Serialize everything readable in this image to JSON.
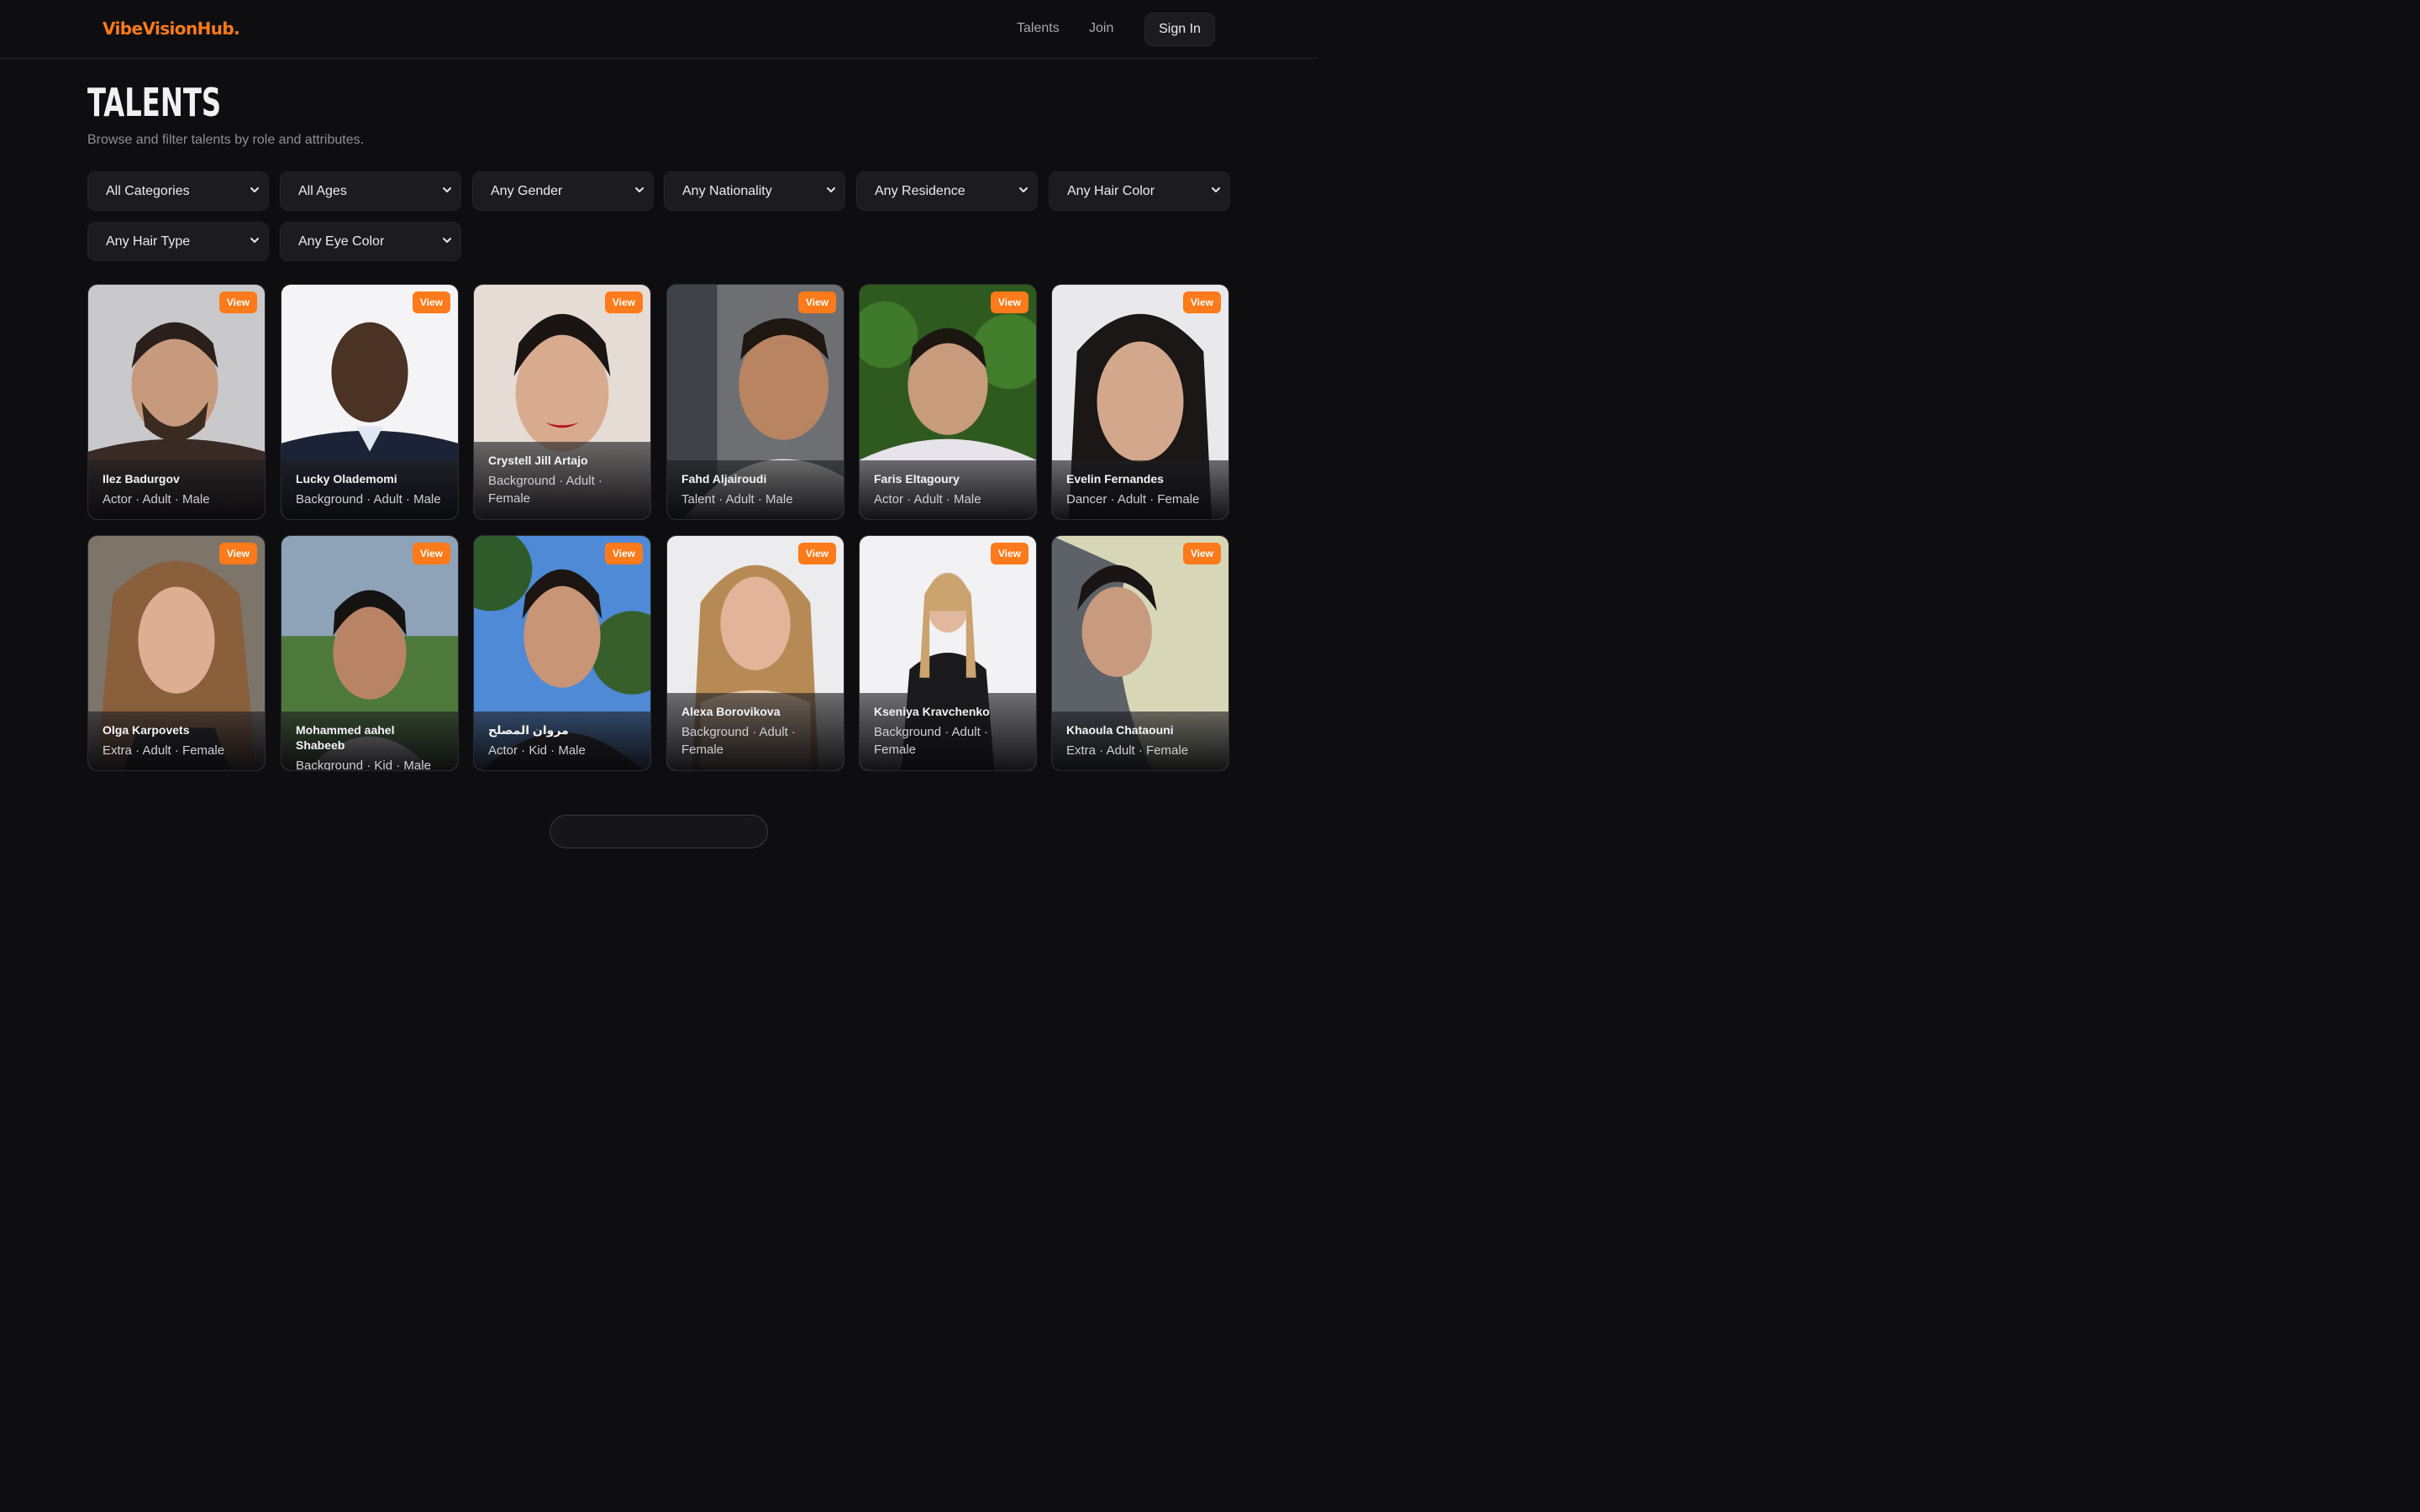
{
  "brand": {
    "logo": "VibeVisionHub.",
    "accent": "#ff7a1a"
  },
  "nav": {
    "talents": "Talents",
    "join": "Join",
    "signin": "Sign In"
  },
  "page": {
    "title": "TALENTS",
    "subtitle": "Browse and filter talents by role and attributes."
  },
  "filters": [
    "All Categories",
    "All Ages",
    "Any Gender",
    "Any Nationality",
    "Any Residence",
    "Any Hair Color",
    "Any Hair Type",
    "Any Eye Color"
  ],
  "view_label": "View",
  "talents": [
    {
      "name": "Ilez Badurgov",
      "meta": "Actor · Adult · Male"
    },
    {
      "name": "Lucky Olademomi",
      "meta": "Background · Adult · Male"
    },
    {
      "name": "Crystell Jill Artajo",
      "meta": "Background · Adult · Female"
    },
    {
      "name": "Fahd Aljairoudi",
      "meta": "Talent · Adult · Male"
    },
    {
      "name": "Faris Eltagoury",
      "meta": "Actor · Adult · Male"
    },
    {
      "name": "Evelin Fernandes",
      "meta": "Dancer · Adult · Female"
    },
    {
      "name": "Olga Karpovets",
      "meta": "Extra · Adult · Female"
    },
    {
      "name": "Mohammed aahel Shabeeb",
      "meta": "Background · Kid · Male"
    },
    {
      "name": "مروان المصلح",
      "meta": "Actor · Kid · Male"
    },
    {
      "name": "Alexa Borovikova",
      "meta": "Background · Adult · Female"
    },
    {
      "name": "Kseniya Kravchenko",
      "meta": "Background · Adult · Female"
    },
    {
      "name": "Khaoula Chataouni",
      "meta": "Extra · Adult · Female"
    }
  ]
}
